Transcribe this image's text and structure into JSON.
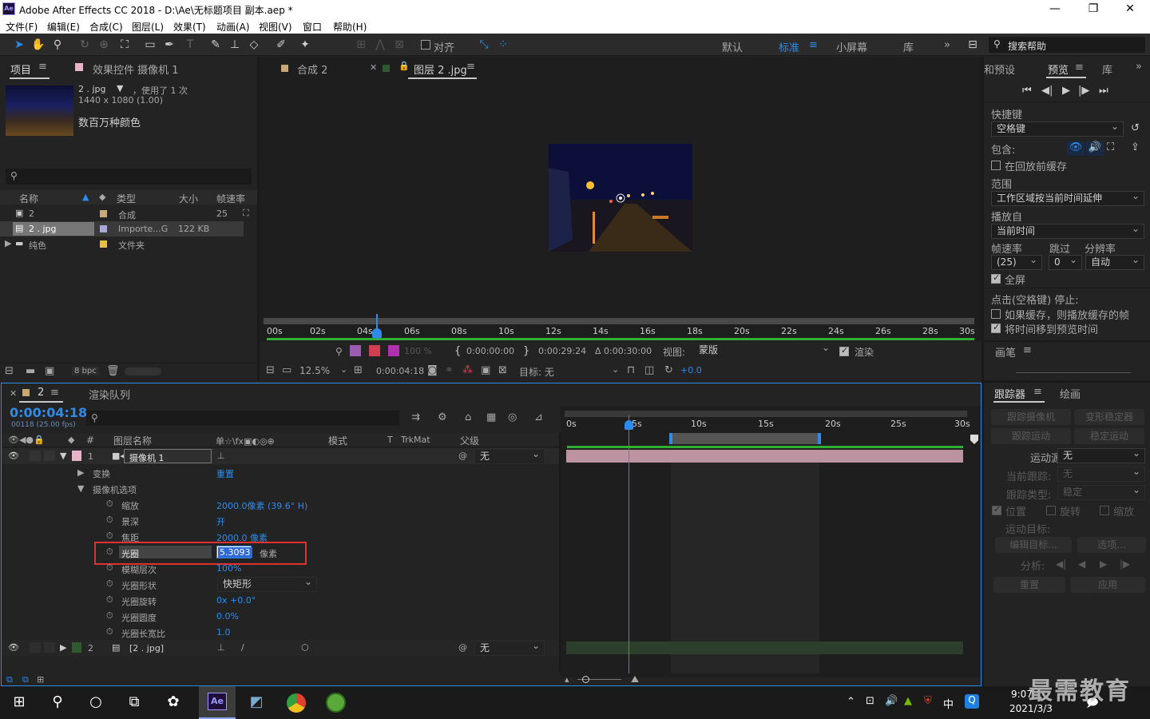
{
  "window": {
    "app_label": "Ae",
    "title": "Adobe After Effects CC 2018 - D:\\Ae\\无标题项目 副本.aep *"
  },
  "menu": [
    "文件(F)",
    "编辑(E)",
    "合成(C)",
    "图层(L)",
    "效果(T)",
    "动画(A)",
    "视图(V)",
    "窗口",
    "帮助(H)"
  ],
  "toolbar": {
    "snap_label": "对齐",
    "workspaces": [
      "默认",
      "标准",
      "小屏幕",
      "库"
    ],
    "search_placeholder": "搜索帮助"
  },
  "project": {
    "tab": "项目",
    "effects_tab": "效果控件 摄像机 1",
    "selected_name": "2 . jpg",
    "used_text": "，使用了 1 次",
    "dimensions": "1440 x 1080 (1.00)",
    "colors": "数百万种颜色",
    "columns": [
      "名称",
      "类型",
      "大小",
      "帧速率"
    ],
    "items": [
      {
        "name": "2",
        "type": "合成",
        "size": "",
        "fps": "25",
        "color": "#c8a878"
      },
      {
        "name": "2 . jpg",
        "type": "Importe...G",
        "size": "122 KB",
        "fps": "",
        "color": "#a8a8d8"
      },
      {
        "name": "纯色",
        "type": "文件夹",
        "size": "",
        "fps": "",
        "color": "#e8c040"
      }
    ],
    "bpc": "8 bpc"
  },
  "viewer": {
    "comp_tab": "合成 2",
    "layer_tab": "图层 2 .jpg",
    "ruler": [
      "00s",
      "02s",
      "04s",
      "06s",
      "08s",
      "10s",
      "12s",
      "14s",
      "16s",
      "18s",
      "20s",
      "22s",
      "24s",
      "26s",
      "28s",
      "30s"
    ],
    "zoom_pct": "100 %",
    "in_time": "0:00:00:00",
    "out_time": "0:00:29:24",
    "duration": "Δ 0:00:30:00",
    "view_label": "视图:",
    "view_value": "蒙版",
    "render_label": "渲染",
    "zoom": "12.5%",
    "current_time": "0:00:04:18",
    "target_label": "目标: 无",
    "exposure": "+0.0"
  },
  "right": {
    "tab_presets": "和预设",
    "tab_preview": "预览",
    "tab_library": "库",
    "shortcut_label": "快捷键",
    "shortcut_value": "空格键",
    "include_label": "包含:",
    "cache_label": "在回放前缓存",
    "range_label": "范围",
    "range_value": "工作区域按当前时间延伸",
    "play_from_label": "播放自",
    "play_from_value": "当前时间",
    "fps_label": "帧速率",
    "skip_label": "跳过",
    "res_label": "分辨率",
    "fps_value": "(25)",
    "skip_value": "0",
    "res_value": "自动",
    "fullscreen_label": "全屏",
    "stop_label": "点击(空格键) 停止:",
    "cached_frames_label": "如果缓存，则播放缓存的帧",
    "move_time_label": "将时间移到预览时间",
    "brush_tab": "画笔",
    "tracker_tab": "跟踪器",
    "paint_tab": "绘画",
    "track_camera": "跟踪摄像机",
    "warp_stabilizer": "变形稳定器",
    "track_motion": "跟踪运动",
    "stabilize_motion": "稳定运动",
    "motion_source_label": "运动源:",
    "motion_source_value": "无",
    "current_track_label": "当前跟踪:",
    "current_track_value": "无",
    "track_type_label": "跟踪类型:",
    "track_type_value": "稳定",
    "position": "位置",
    "rotation": "旋转",
    "scale": "缩放",
    "motion_target_label": "运动目标:",
    "edit_target": "编辑目标...",
    "options": "选项...",
    "analyze_label": "分析:",
    "reset": "重置",
    "apply": "应用"
  },
  "timeline": {
    "comp_tab": "2",
    "render_queue_tab": "渲染队列",
    "timecode": "0:00:04:18",
    "frames": "00118 (25.00 fps)",
    "col_num": "#",
    "col_name": "图层名称",
    "col_switches": "单☆\\fx▣◐◎⊕",
    "col_mode": "模式",
    "col_t": "T",
    "col_trkmat": "TrkMat",
    "col_parent": "父级",
    "ruler": [
      "0s",
      "5s",
      "10s",
      "15s",
      "20s",
      "25s",
      "30s"
    ],
    "layers": [
      {
        "num": "1",
        "name": "摄像机 1",
        "parent": "无",
        "color": "#e8b4c8"
      },
      {
        "num": "2",
        "name": "[2 . jpg]",
        "parent": "无",
        "color": "#2f5a2f"
      }
    ],
    "transform_label": "变换",
    "transform_value": "重置",
    "camera_options_label": "摄像机选项",
    "props": [
      {
        "name": "缩放",
        "value": "2000.0像素 (39.6° H)"
      },
      {
        "name": "景深",
        "value": "开"
      },
      {
        "name": "焦距",
        "value": "2000.0 像素"
      },
      {
        "name": "光圈",
        "value": "5.3093",
        "unit": "像素"
      },
      {
        "name": "模糊层次",
        "value": "100%"
      },
      {
        "name": "光圈形状",
        "value": "快矩形"
      },
      {
        "name": "光圈旋转",
        "value": "0x +0.0°"
      },
      {
        "name": "光圈圆度",
        "value": "0.0%"
      },
      {
        "name": "光圈长宽比",
        "value": "1.0"
      }
    ]
  },
  "taskbar": {
    "time": "9:07",
    "date": "2021/3/3",
    "ime": "中",
    "watermark": "最需教育"
  }
}
